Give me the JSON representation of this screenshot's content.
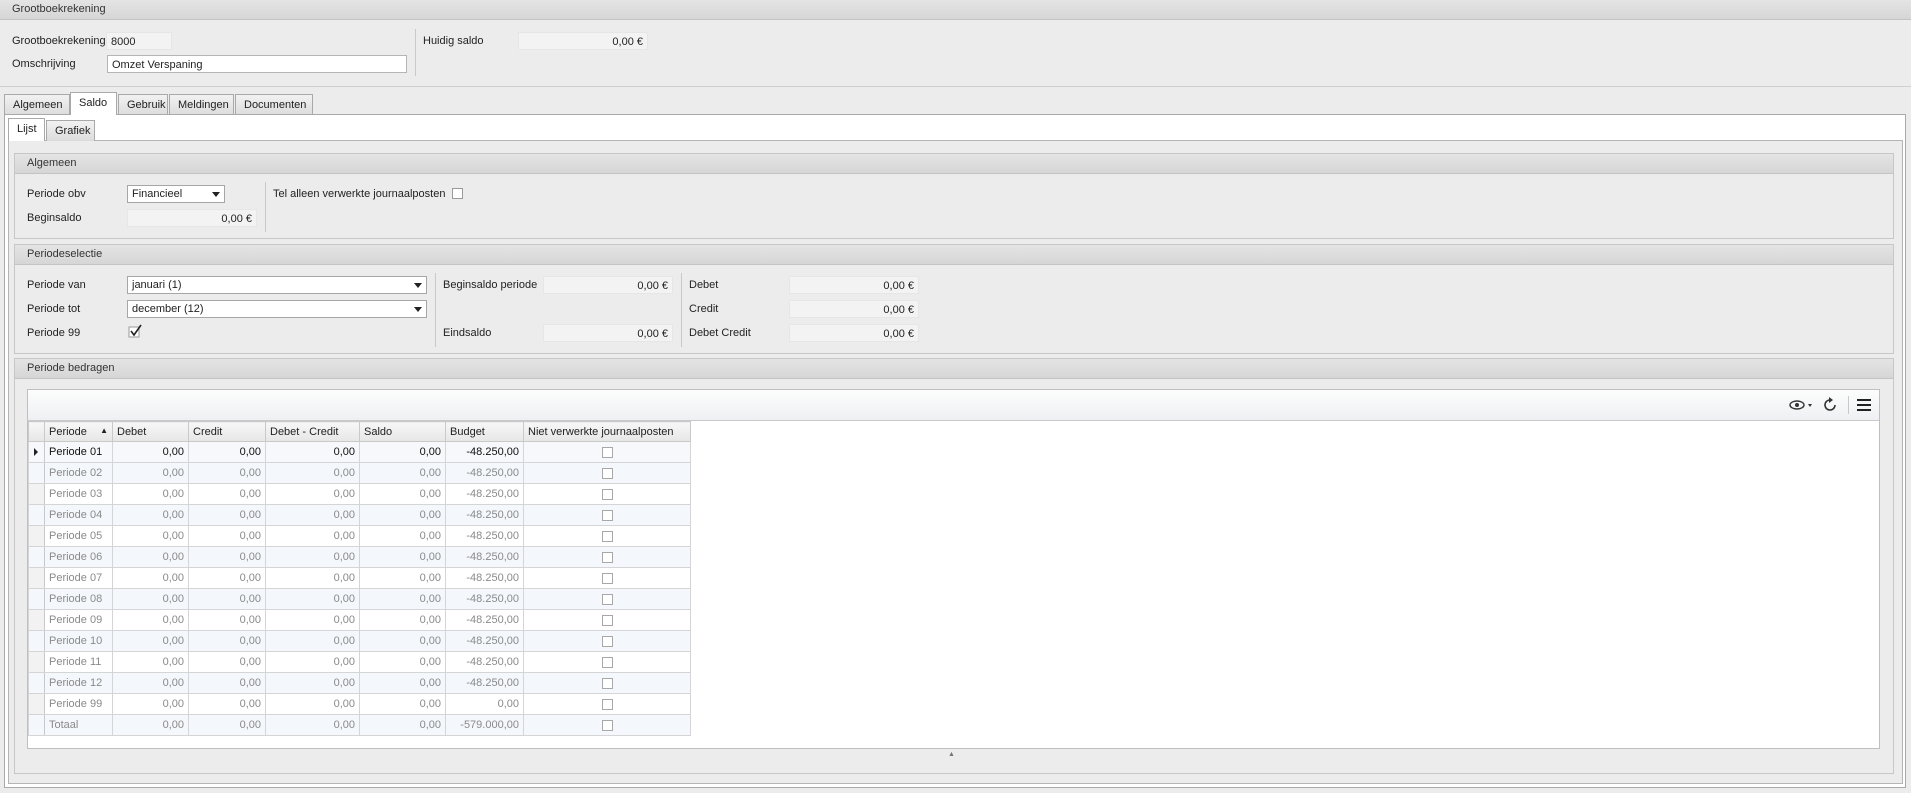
{
  "header": {
    "title": "Grootboekrekening",
    "account_label": "Grootboekrekening",
    "account_value": "8000",
    "desc_label": "Omschrijving",
    "desc_value": "Omzet Verspaning",
    "balance_label": "Huidig saldo",
    "balance_value": "0,00 €"
  },
  "tabs": [
    {
      "label": "Algemeen"
    },
    {
      "label": "Saldo",
      "active": true
    },
    {
      "label": "Gebruik"
    },
    {
      "label": "Meldingen"
    },
    {
      "label": "Documenten"
    }
  ],
  "subtabs": [
    {
      "label": "Lijst",
      "active": true
    },
    {
      "label": "Grafiek"
    }
  ],
  "general": {
    "title": "Algemeen",
    "period_basis_label": "Periode obv",
    "period_basis_value": "Financieel",
    "only_processed_label": "Tel alleen verwerkte journaalposten",
    "only_processed_checked": false,
    "opening_label": "Beginsaldo",
    "opening_value": "0,00 €"
  },
  "selection": {
    "title": "Periodeselectie",
    "from_label": "Periode van",
    "from_value": "januari (1)",
    "to_label": "Periode tot",
    "to_value": "december (12)",
    "p99_label": "Periode 99",
    "p99_checked": true,
    "open_period_label": "Beginsaldo periode",
    "open_period_value": "0,00 €",
    "end_label": "Eindsaldo",
    "end_value": "0,00 €",
    "debit_label": "Debet",
    "debit_value": "0,00 €",
    "credit_label": "Credit",
    "credit_value": "0,00 €",
    "dc_label": "Debet Credit",
    "dc_value": "0,00 €"
  },
  "amounts": {
    "title": "Periode bedragen",
    "columns": [
      "Periode",
      "Debet",
      "Credit",
      "Debet - Credit",
      "Saldo",
      "Budget",
      "Niet verwerkte journaalposten"
    ],
    "rows": [
      {
        "period": "Periode 01",
        "debit": "0,00",
        "credit": "0,00",
        "dc": "0,00",
        "saldo": "0,00",
        "budget": "-48.250,00"
      },
      {
        "period": "Periode 02",
        "debit": "0,00",
        "credit": "0,00",
        "dc": "0,00",
        "saldo": "0,00",
        "budget": "-48.250,00"
      },
      {
        "period": "Periode 03",
        "debit": "0,00",
        "credit": "0,00",
        "dc": "0,00",
        "saldo": "0,00",
        "budget": "-48.250,00"
      },
      {
        "period": "Periode 04",
        "debit": "0,00",
        "credit": "0,00",
        "dc": "0,00",
        "saldo": "0,00",
        "budget": "-48.250,00"
      },
      {
        "period": "Periode 05",
        "debit": "0,00",
        "credit": "0,00",
        "dc": "0,00",
        "saldo": "0,00",
        "budget": "-48.250,00"
      },
      {
        "period": "Periode 06",
        "debit": "0,00",
        "credit": "0,00",
        "dc": "0,00",
        "saldo": "0,00",
        "budget": "-48.250,00"
      },
      {
        "period": "Periode 07",
        "debit": "0,00",
        "credit": "0,00",
        "dc": "0,00",
        "saldo": "0,00",
        "budget": "-48.250,00"
      },
      {
        "period": "Periode 08",
        "debit": "0,00",
        "credit": "0,00",
        "dc": "0,00",
        "saldo": "0,00",
        "budget": "-48.250,00"
      },
      {
        "period": "Periode 09",
        "debit": "0,00",
        "credit": "0,00",
        "dc": "0,00",
        "saldo": "0,00",
        "budget": "-48.250,00"
      },
      {
        "period": "Periode 10",
        "debit": "0,00",
        "credit": "0,00",
        "dc": "0,00",
        "saldo": "0,00",
        "budget": "-48.250,00"
      },
      {
        "period": "Periode 11",
        "debit": "0,00",
        "credit": "0,00",
        "dc": "0,00",
        "saldo": "0,00",
        "budget": "-48.250,00"
      },
      {
        "period": "Periode 12",
        "debit": "0,00",
        "credit": "0,00",
        "dc": "0,00",
        "saldo": "0,00",
        "budget": "-48.250,00"
      },
      {
        "period": "Periode 99",
        "debit": "0,00",
        "credit": "0,00",
        "dc": "0,00",
        "saldo": "0,00",
        "budget": "0,00"
      },
      {
        "period": "Totaal",
        "debit": "0,00",
        "credit": "0,00",
        "dc": "0,00",
        "saldo": "0,00",
        "budget": "-579.000,00"
      }
    ],
    "toolbar_icons": [
      "view-options-icon",
      "refresh-icon",
      "menu-icon"
    ]
  }
}
